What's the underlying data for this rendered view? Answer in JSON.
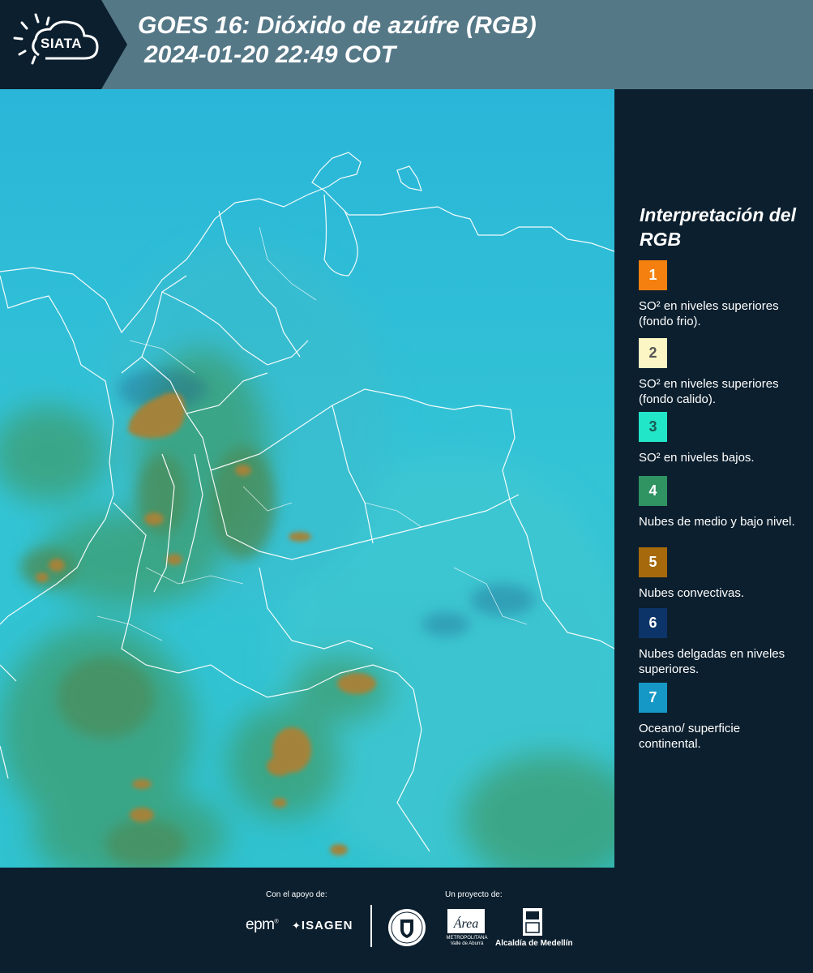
{
  "header": {
    "logo_text": "SIATA",
    "title_line1": "GOES 16: Dióxido de azúfre (RGB)",
    "title_line2": "2024-01-20 22:49 COT",
    "background_color": "#557887"
  },
  "legend": {
    "title": "Interpretación del RGB",
    "items": [
      {
        "number": "1",
        "label": "SO² en niveles superiores (fondo frio).",
        "color": "#f5800f",
        "text_color": "#ffffff"
      },
      {
        "number": "2",
        "label": "SO² en niveles superiores (fondo calido).",
        "color": "#fcf6c4",
        "text_color": "#555555"
      },
      {
        "number": "3",
        "label": "SO² en niveles bajos.",
        "color": "#22e6c8",
        "text_color": "#1a5a55"
      },
      {
        "number": "4",
        "label": "Nubes de medio y bajo nivel.",
        "color": "#2f9362",
        "text_color": "#ffffff"
      },
      {
        "number": "5",
        "label": "Nubes convectivas.",
        "color": "#a66a0c",
        "text_color": "#ffffff"
      },
      {
        "number": "6",
        "label": "Nubes delgadas en niveles superiores.",
        "color": "#0d3469",
        "text_color": "#ffffff"
      },
      {
        "number": "7",
        "label": "Oceano/ superficie continental.",
        "color": "#1598c6",
        "text_color": "#ffffff"
      }
    ]
  },
  "footer": {
    "support_label": "Con el apoyo de:",
    "project_label": "Un proyecto de:",
    "sponsor_1": "epm",
    "sponsor_2": "ISAGEN",
    "partner_amva": "Área",
    "partner_amva_sub": "METROPOLITANA Valle de Aburrá",
    "partner_alcaldia": "Alcaldía de Medellín"
  },
  "colors": {
    "panel": "#0c1f2e",
    "ocean": "#2fc0d6",
    "convective": "#a8822a",
    "low_cloud": "#3f9a6a"
  }
}
